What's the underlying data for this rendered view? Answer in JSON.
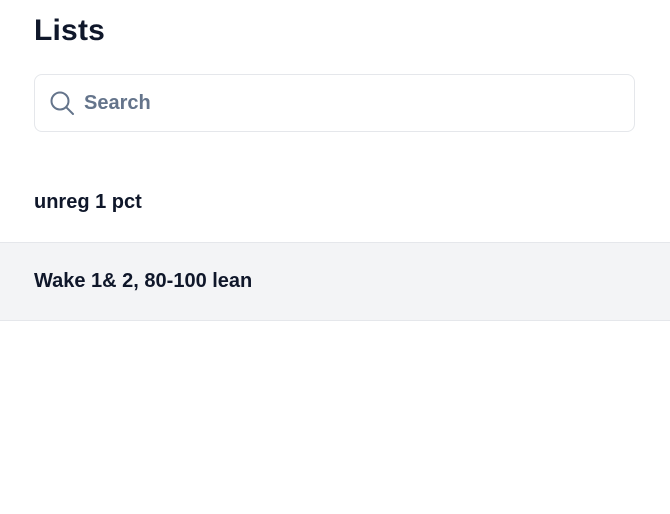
{
  "header": {
    "title": "Lists"
  },
  "search": {
    "placeholder": "Search",
    "value": "",
    "icon": "search-icon"
  },
  "lists": [
    {
      "label": "unreg 1 pct",
      "selected": false
    },
    {
      "label": "Wake 1& 2, 80-100 lean",
      "selected": true
    }
  ],
  "colors": {
    "selected_row_bg": "#f3f4f6",
    "border": "#e5e7eb",
    "placeholder": "#64748b",
    "text": "#0f172a"
  }
}
